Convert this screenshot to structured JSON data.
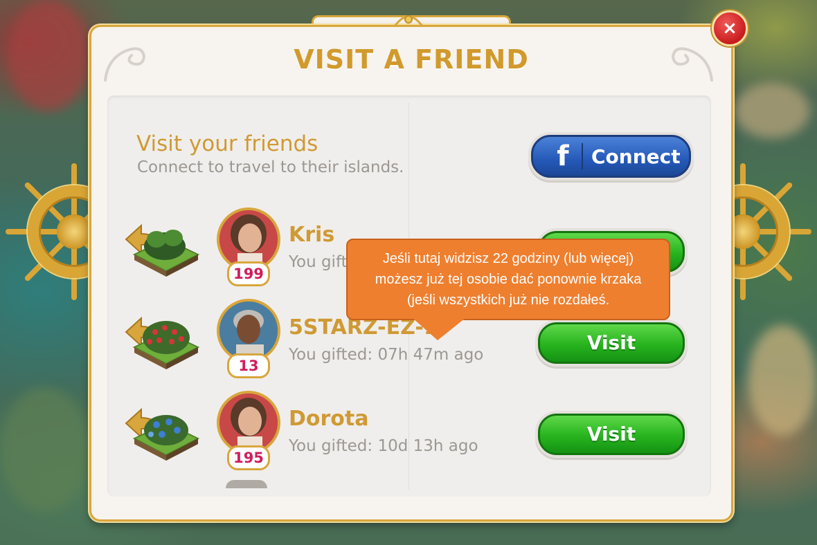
{
  "dialog": {
    "title": "VISIT A FRIEND",
    "close_icon": "×"
  },
  "intro": {
    "heading": "Visit your friends",
    "subtitle": "Connect to travel to their islands.",
    "connect_label": "Connect",
    "facebook_glyph": "f"
  },
  "friends": [
    {
      "name": "Kris",
      "level": "199",
      "gifted": "You gifted",
      "visit_label": "Visit",
      "bush": "green-bush"
    },
    {
      "name": "5STARZ-EZ-1",
      "level": "13",
      "gifted": "You gifted: 07h 47m ago",
      "visit_label": "Visit",
      "bush": "berry-bush"
    },
    {
      "name": "Dorota",
      "level": "195",
      "gifted": "You gifted: 10d 13h ago",
      "visit_label": "Visit",
      "bush": "blue-flower-bush"
    }
  ],
  "callout": {
    "lines": [
      "Jeśli tutaj widzisz 22 godziny (lub więcej)",
      "możesz już tej osobie dać ponownie krzaka",
      "(jeśli wszystkich już nie rozdałeś."
    ]
  },
  "colors": {
    "title_gold": "#d19a2c",
    "visit_green": "#27b31e",
    "facebook_blue": "#2559b8",
    "callout_orange": "#ee7f2f",
    "level_pink": "#d01d5c"
  }
}
